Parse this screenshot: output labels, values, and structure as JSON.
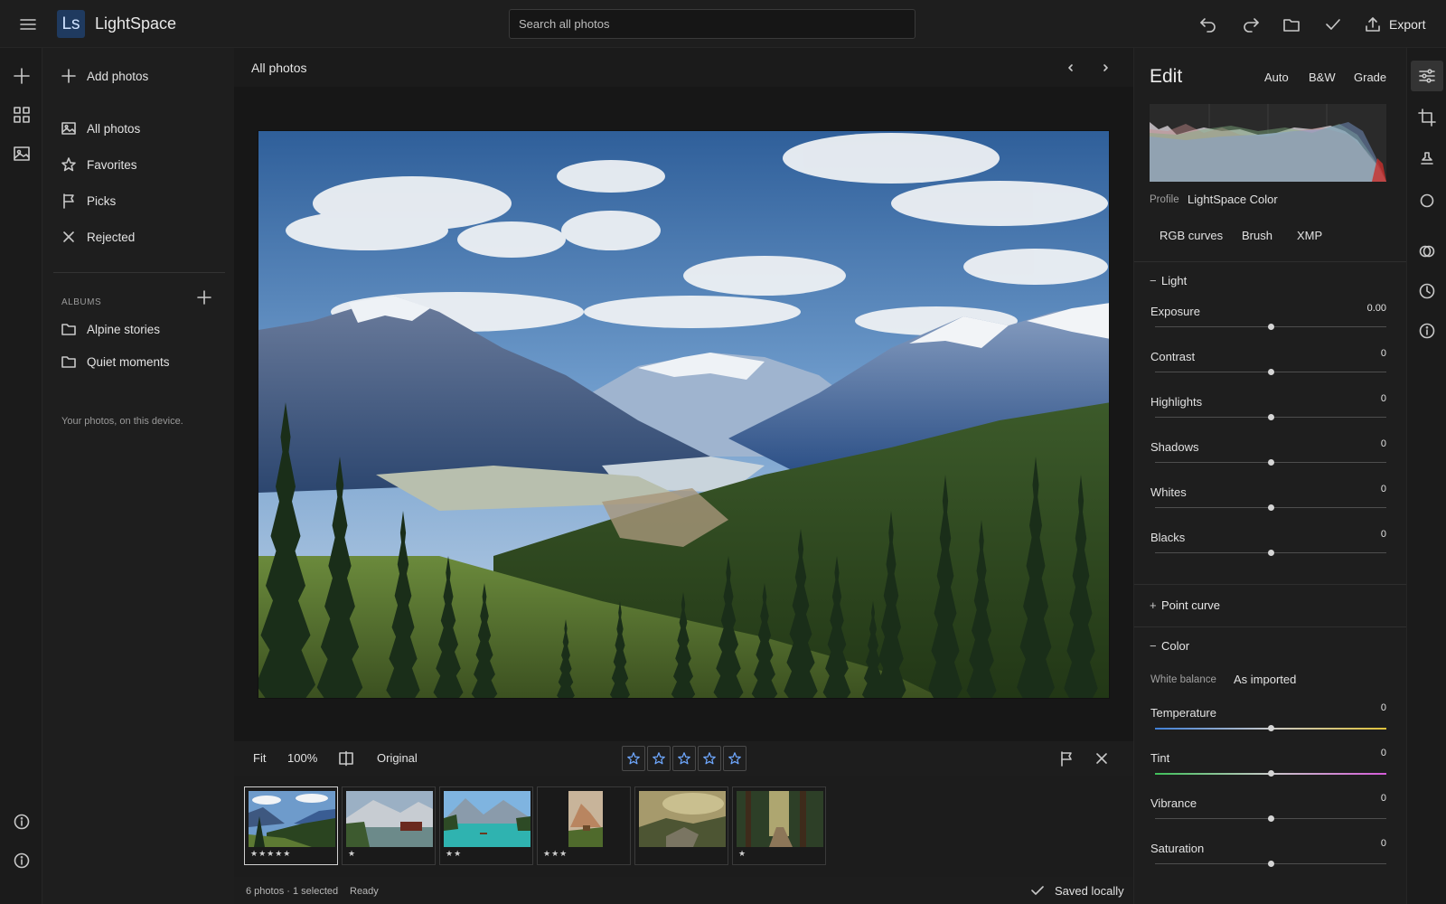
{
  "app": {
    "logo_text": "Ls",
    "name": "LightSpace"
  },
  "search": {
    "placeholder": "Search all photos"
  },
  "toolbar": {
    "export_label": "Export"
  },
  "nav": {
    "add_photos": "Add photos",
    "items": [
      {
        "label": "All photos",
        "icon": "image-icon"
      },
      {
        "label": "Favorites",
        "icon": "star-icon"
      },
      {
        "label": "Picks",
        "icon": "flag-icon"
      },
      {
        "label": "Rejected",
        "icon": "x-icon"
      }
    ],
    "albums_heading": "ALBUMS",
    "albums": [
      {
        "label": "Alpine stories"
      },
      {
        "label": "Quiet moments"
      }
    ],
    "footer": "Your photos, on this device."
  },
  "view": {
    "title": "All photos"
  },
  "view_toolbar": {
    "fit": "Fit",
    "zoom": "100%",
    "compare": "Original"
  },
  "rating": {
    "stars": 5,
    "value": 0
  },
  "filmstrip": [
    {
      "stars": "★★★★★",
      "selected": true
    },
    {
      "stars": "★",
      "selected": false
    },
    {
      "stars": "★★",
      "selected": false
    },
    {
      "stars": "★★★",
      "selected": false
    },
    {
      "stars": "",
      "selected": false
    },
    {
      "stars": "★",
      "selected": false
    }
  ],
  "status": {
    "count": "6 photos · 1 selected",
    "state": "Ready",
    "saved": "Saved locally"
  },
  "edit": {
    "title": "Edit",
    "presets": [
      "Auto",
      "B&W",
      "Grade"
    ],
    "profile_label": "Profile",
    "profile_value": "LightSpace Color",
    "chips": [
      "RGB curves",
      "Brush",
      "XMP"
    ],
    "light": {
      "title": "Light",
      "sliders": [
        {
          "label": "Exposure",
          "value": "0.00",
          "pos": 0.5
        },
        {
          "label": "Contrast",
          "value": "0",
          "pos": 0.5
        },
        {
          "label": "Highlights",
          "value": "0",
          "pos": 0.5
        },
        {
          "label": "Shadows",
          "value": "0",
          "pos": 0.5
        },
        {
          "label": "Whites",
          "value": "0",
          "pos": 0.5
        },
        {
          "label": "Blacks",
          "value": "0",
          "pos": 0.5
        }
      ]
    },
    "point_curve": {
      "title": "Point curve"
    },
    "color": {
      "title": "Color",
      "wb_label": "White balance",
      "wb_value": "As imported",
      "sliders": [
        {
          "label": "Temperature",
          "value": "0",
          "pos": 0.5
        },
        {
          "label": "Tint",
          "value": "0",
          "pos": 0.5
        },
        {
          "label": "Vibrance",
          "value": "0",
          "pos": 0.5
        },
        {
          "label": "Saturation",
          "value": "0",
          "pos": 0.5
        }
      ]
    }
  },
  "colors": {
    "logo_bg": "#1f3a5f",
    "accent_star": "#6fa8ff"
  }
}
